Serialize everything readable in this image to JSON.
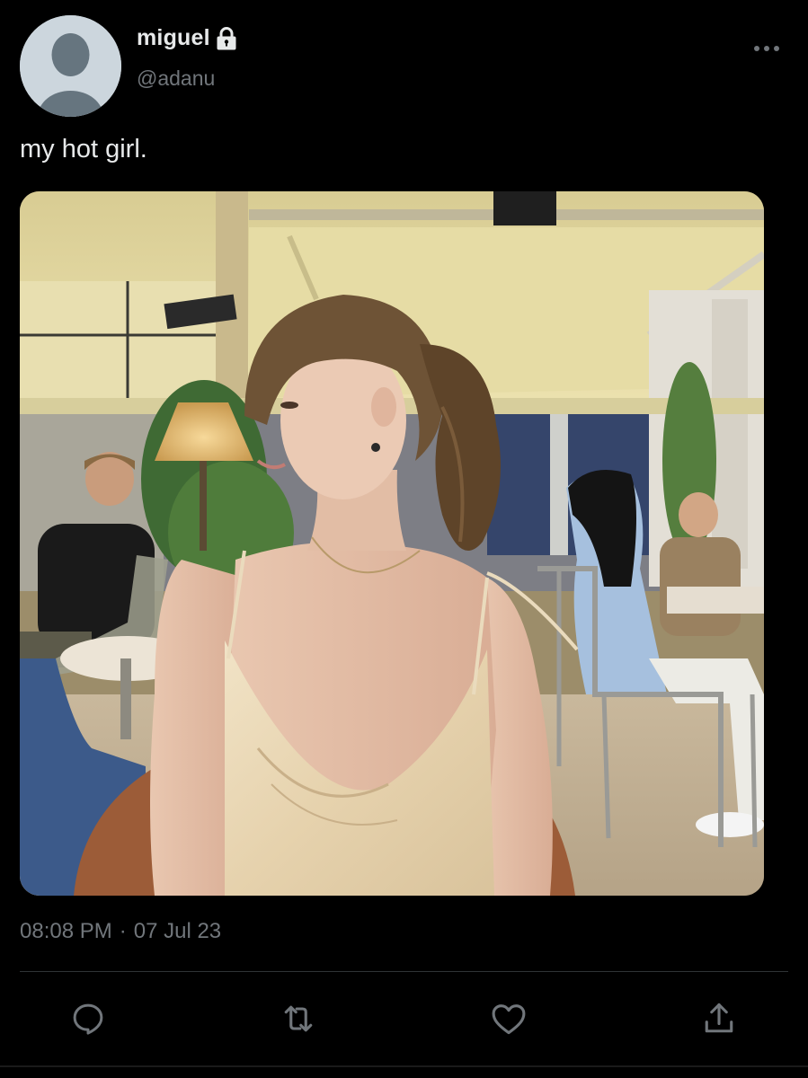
{
  "author": {
    "display_name": "miguel",
    "handle": "@adanu",
    "protected": true
  },
  "tweet": {
    "text": "my hot girl.",
    "time": "08:08 PM",
    "separator": "·",
    "date": "07 Jul 23"
  },
  "icons": {
    "avatar": "default-avatar-silhouette",
    "lock": "lock-icon",
    "more": "more-horizontal-icon",
    "reply": "reply-icon",
    "retweet": "retweet-icon",
    "like": "heart-icon",
    "share": "share-icon"
  },
  "colors": {
    "background": "#000000",
    "text_primary": "#e7e9ea",
    "text_secondary": "#71767b",
    "divider": "#2f3336",
    "avatar_bg": "#ccd6dd",
    "avatar_fg": "#66757f"
  }
}
